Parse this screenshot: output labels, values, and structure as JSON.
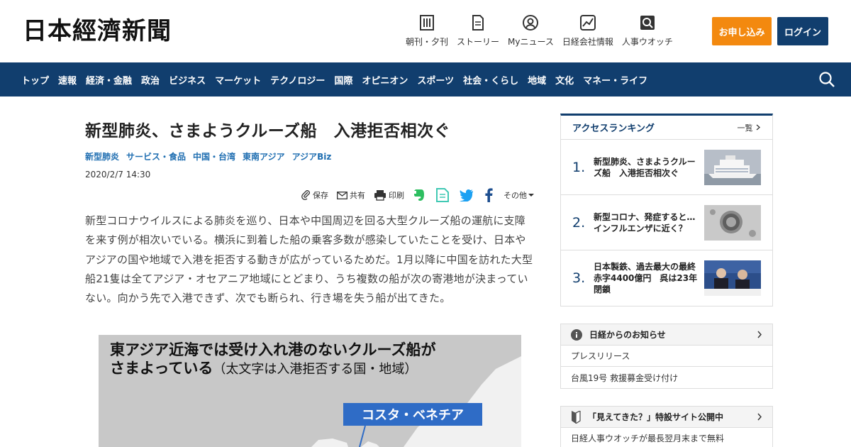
{
  "header": {
    "logo": "日本經濟新聞",
    "nav": [
      {
        "label": "朝刊・夕刊",
        "icon": "newspaper-icon"
      },
      {
        "label": "ストーリー",
        "icon": "document-icon"
      },
      {
        "label": "Myニュース",
        "icon": "person-icon"
      },
      {
        "label": "日経会社情報",
        "icon": "chart-icon"
      },
      {
        "label": "人事ウオッチ",
        "icon": "magnifier-icon"
      }
    ],
    "apply_label": "お申し込み",
    "login_label": "ログイン"
  },
  "navbar": {
    "items": [
      "トップ",
      "速報",
      "経済・金融",
      "政治",
      "ビジネス",
      "マーケット",
      "テクノロジー",
      "国際",
      "オピニオン",
      "スポーツ",
      "社会・くらし",
      "地域",
      "文化",
      "マネー・ライフ"
    ]
  },
  "article": {
    "title": "新型肺炎、さまようクルーズ船　入港拒否相次ぐ",
    "tags": [
      "新型肺炎",
      "サービス・食品",
      "中国・台湾",
      "東南アジア",
      "アジアBiz"
    ],
    "date": "2020/2/7 14:30",
    "tools": {
      "save": "保存",
      "share": "共有",
      "print": "印刷",
      "other": "その他"
    },
    "body": "新型コロナウイルスによる肺炎を巡り、日本や中国周辺を回る大型クルーズ船の運航に支障を来す例が相次いでいる。横浜に到着した船の乗客多数が感染していたことを受け、日本やアジアの国や地域で入港を拒否する動きが広がっているためだ。1月以降に中国を訪れた大型船21隻は全てアジア・オセアニア地域にとどまり、うち複数の船が次の寄港地が決まっていない。向かう先で入港できず、次でも断られ、行き場を失う船が出てきた。",
    "figure": {
      "title_line1": "東アジア近海では受け入れ港のないクルーズ船が",
      "title_line2": "さまよっている",
      "title_paren": "（太文字は入港拒否する国・地域）",
      "ship_label": "コスタ・ベネチア"
    }
  },
  "ranking": {
    "title": "アクセスランキング",
    "more": "一覧",
    "items": [
      {
        "rank": "1.",
        "text": "新型肺炎、さまようクルーズ船　入港拒否相次ぐ"
      },
      {
        "rank": "2.",
        "text": "新型コロナ、発症すると…インフルエンザに近く？"
      },
      {
        "rank": "3.",
        "text": "日本製鉄、過去最大の最終赤字4400億円　呉は23年閉鎖"
      }
    ]
  },
  "notice": {
    "title": "日経からのお知らせ",
    "rows": [
      "プレスリリース",
      "台風19号 救援募金受け付け"
    ]
  },
  "special": {
    "title": "「見えてきた？」特設サイト公開中",
    "row": "日経人事ウオッチが最長翌月末まで無料"
  }
}
